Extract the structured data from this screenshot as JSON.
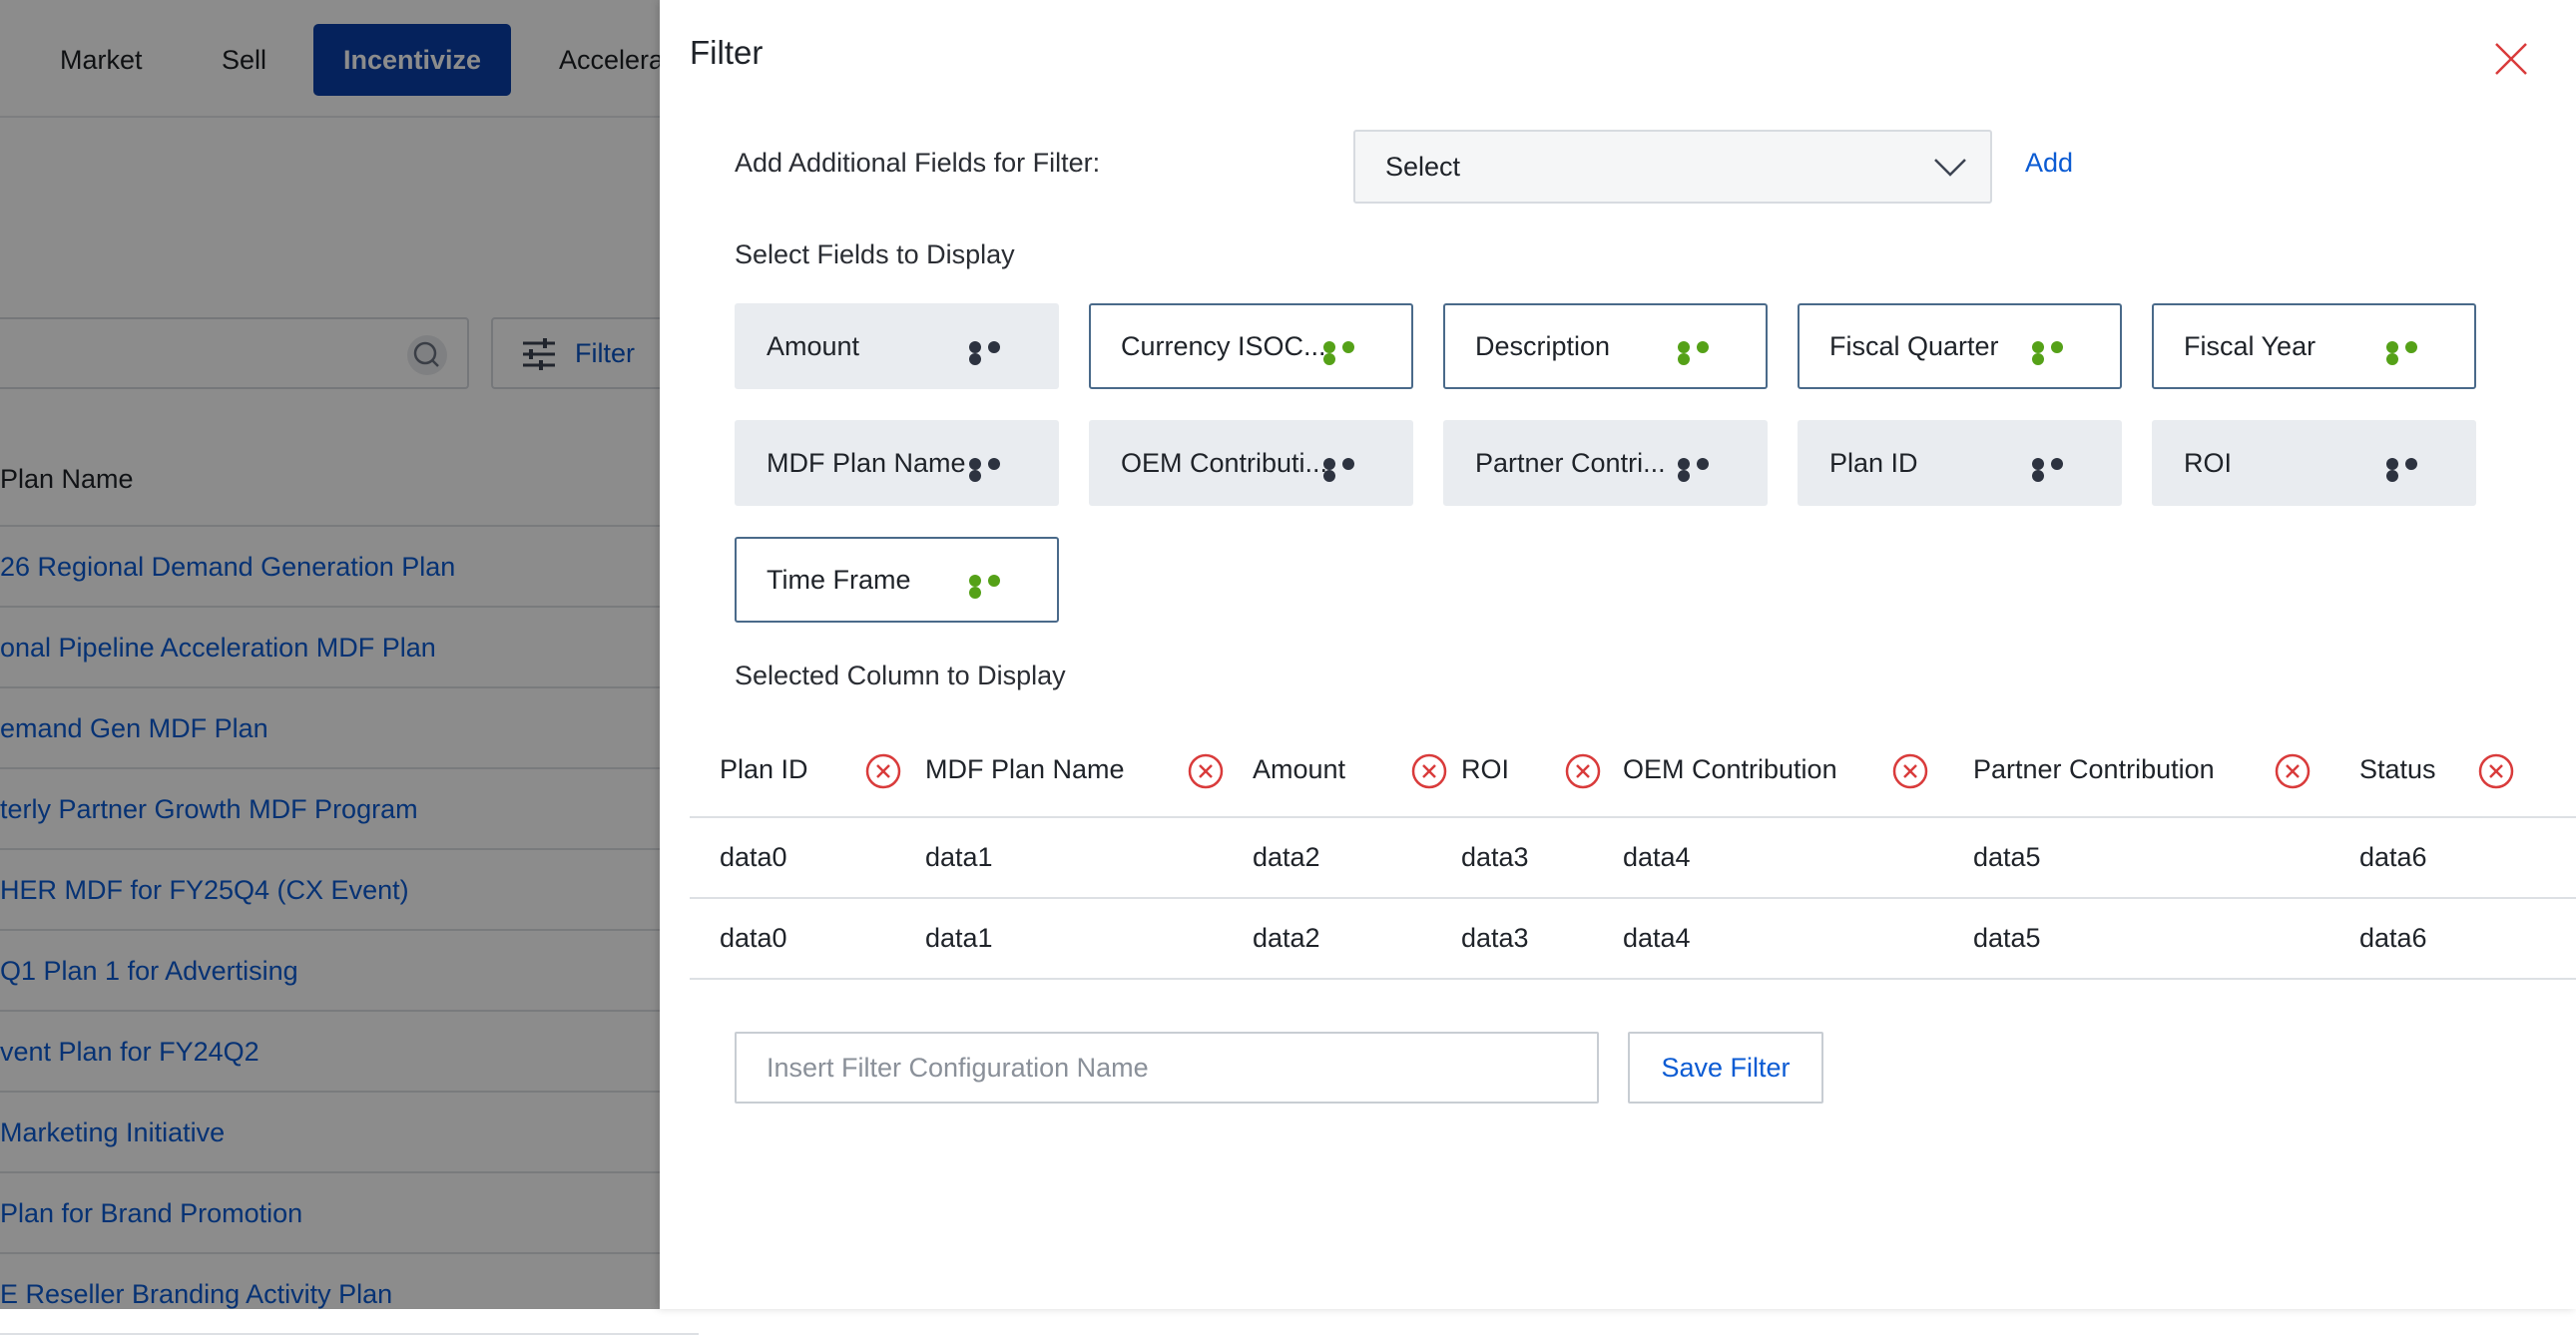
{
  "nav": {
    "items": [
      "Market",
      "Sell",
      "Incentivize",
      "Accelera"
    ],
    "active": "Incentivize"
  },
  "background": {
    "filter_label": "Filter",
    "column_header": "Plan Name",
    "rows": [
      "26 Regional Demand Generation Plan",
      "onal Pipeline Acceleration MDF Plan",
      "emand Gen MDF Plan",
      "terly Partner Growth MDF Program",
      "HER MDF for FY25Q4 (CX Event)",
      "Q1 Plan 1 for Advertising",
      "vent Plan for FY24Q2",
      "Marketing Initiative",
      " Plan for Brand Promotion",
      "E Reseller Branding Activity Plan"
    ]
  },
  "panel": {
    "title": "Filter",
    "add_fields_label": "Add Additional Fields for Filter:",
    "select_value": "Select",
    "add_link": "Add",
    "display_fields_label": "Select Fields to Display",
    "selected_columns_label": "Selected Column to Display",
    "config_placeholder": "Insert Filter Configuration Name",
    "save_button": "Save Filter"
  },
  "fields": [
    {
      "label": "Amount",
      "state": "grey"
    },
    {
      "label": "Currency ISOC...",
      "state": "selected"
    },
    {
      "label": "Description",
      "state": "selected"
    },
    {
      "label": "Fiscal Quarter",
      "state": "selected"
    },
    {
      "label": "Fiscal Year",
      "state": "selected"
    },
    {
      "label": "MDF Plan Name",
      "state": "grey"
    },
    {
      "label": "OEM Contributi...",
      "state": "grey"
    },
    {
      "label": "Partner Contri...",
      "state": "grey"
    },
    {
      "label": "Plan ID",
      "state": "grey"
    },
    {
      "label": "ROI",
      "state": "grey"
    },
    {
      "label": "Time Frame",
      "state": "selected"
    }
  ],
  "selected_columns": {
    "headers": [
      "Plan ID",
      "MDF Plan Name",
      "Amount",
      "ROI",
      "OEM Contribution",
      "Partner Contribution",
      "Status"
    ],
    "rows": [
      [
        "data0",
        "data1",
        "data2",
        "data3",
        "data4",
        "data5",
        "data6"
      ],
      [
        "data0",
        "data1",
        "data2",
        "data3",
        "data4",
        "data5",
        "data6"
      ]
    ]
  },
  "colors": {
    "accent": "#0b5bd3",
    "active_nav": "#0a3fa8",
    "dots_selected": "#55a118",
    "dots_unselected": "#2d3340",
    "remove_icon": "#d93b3b"
  }
}
